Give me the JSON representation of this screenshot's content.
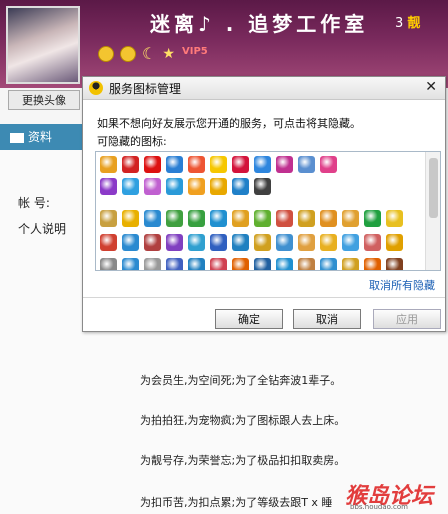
{
  "header": {
    "nickname": "迷离♪ . 追梦工作室",
    "level_prefix": "3",
    "level_badge": "靓",
    "vip_label": "VIP5",
    "change_avatar_label": "更换头像"
  },
  "sidebar": {
    "tab_profile_label": "资料"
  },
  "profile": {
    "account_label": "帐  号:",
    "bio_label": "个人说明",
    "lines": [
      "为会员生,为空间死;为了全钻奔波1辈子。",
      "为拍拍狂,为宠物疯;为了图标跟人去上床。",
      "为靓号存,为荣誉忘;为了极品扣扣取卖房。",
      "为扣币苦,为扣点累;为了等级去跟T x 睡"
    ]
  },
  "watermark": {
    "text": "猴岛论坛",
    "sub": "bbs.houdao.com"
  },
  "dialog": {
    "title": "服务图标管理",
    "description": "如果不想向好友展示您开通的服务，可点击将其隐藏。",
    "hideable_label": "可隐藏的图标:",
    "cancel_all_label": "取消所有隐藏",
    "ok_label": "确定",
    "cancel_label": "取消",
    "apply_label": "应用",
    "colors": {
      "row1": [
        "#e8a020",
        "#d22222",
        "#d11",
        "#2a7fd4",
        "#e53",
        "#f6c700",
        "#d3133b",
        "#2e86de",
        "#c03090",
        "#5a8fd0",
        "#e0408a"
      ],
      "row2": [
        "#8b3ac8",
        "#2fa0e0",
        "#c060d0",
        "#2a9ad8",
        "#f0a020",
        "#e8a800",
        "#2080c8",
        "#404040"
      ],
      "row3": [
        "#c8a040",
        "#e8b000",
        "#2a8ad0",
        "#40a040",
        "#38a040",
        "#2090d0",
        "#e0a020",
        "#60b030",
        "#d05040",
        "#d0a020",
        "#e09020",
        "#e0a030",
        "#20a040",
        "#e8c020"
      ],
      "row4": [
        "#d04030",
        "#2a8ad0",
        "#b04040",
        "#8040c0",
        "#30a0d0",
        "#3060c0",
        "#2080c0",
        "#d0a020",
        "#4090d0",
        "#e0a040",
        "#e8b020",
        "#40a0e0",
        "#d06060",
        "#e0a000"
      ],
      "row5": [
        "#888",
        "#2a8ad0",
        "#999",
        "#4060c0",
        "#2080c0",
        "#d04050",
        "#e06000",
        "#2060a0",
        "#2090d0",
        "#c08040",
        "#3090d0",
        "#d0a020",
        "#e06000",
        "#804020"
      ]
    }
  }
}
